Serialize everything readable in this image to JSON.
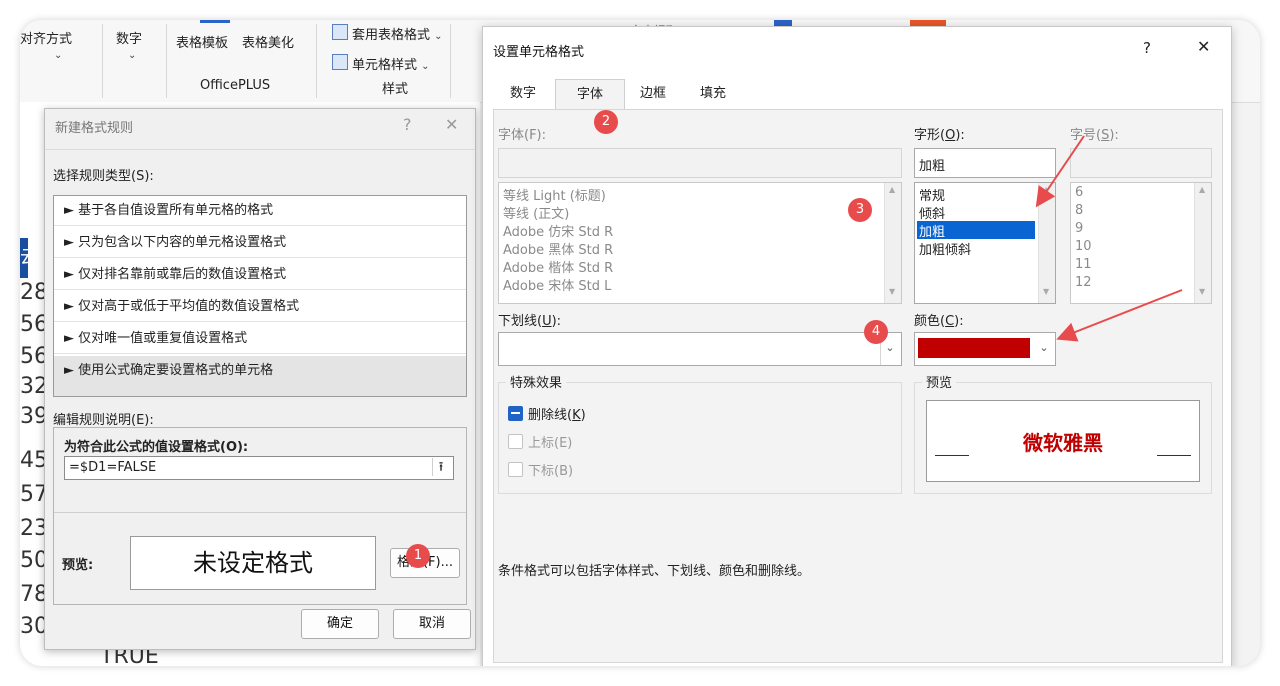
{
  "ribbon": {
    "alignment_label": "对齐方式",
    "number_label": "数字",
    "table_template_label": "表格模板",
    "table_beautify_label": "表格美化",
    "apply_table_style_label": "套用表格格式",
    "cell_style_label": "单元格样式",
    "officeplus_group": "OfficePLUS",
    "style_group": "样式",
    "text_extract_label": "文本提取"
  },
  "sheet": {
    "partial_cells": [
      "28",
      "56",
      "56",
      "32",
      "39",
      "45",
      "57",
      "23",
      "50",
      "78",
      "30"
    ],
    "bottom_cell": "TRUE",
    "left_header_fragment": "云春"
  },
  "new_rule_dialog": {
    "title": "新建格式规则",
    "help": "?",
    "close": "✕",
    "select_rule_type_label": "选择规则类型(S):",
    "rules": [
      "► 基于各自值设置所有单元格的格式",
      "► 只为包含以下内容的单元格设置格式",
      "► 仅对排名靠前或靠后的数值设置格式",
      "► 仅对高于或低于平均值的数值设置格式",
      "► 仅对唯一值或重复值设置格式",
      "► 使用公式确定要设置格式的单元格"
    ],
    "edit_rule_label": "编辑规则说明(E):",
    "formula_label": "为符合此公式的值设置格式(O):",
    "formula_value": "=$D1=FALSE",
    "preview_label": "预览:",
    "preview_text": "未设定格式",
    "format_button": "格式(F)...",
    "ok_button": "确定",
    "cancel_button": "取消"
  },
  "format_cells_dialog": {
    "title": "设置单元格格式",
    "help": "?",
    "close": "✕",
    "tabs": [
      "数字",
      "字体",
      "边框",
      "填充"
    ],
    "active_tab": "字体",
    "font_label": "字体(F):",
    "font_input": "",
    "font_list": [
      "等线 Light (标题)",
      "等线 (正文)",
      "Adobe 仿宋 Std R",
      "Adobe 黑体 Std R",
      "Adobe 楷体 Std R",
      "Adobe 宋体 Std L"
    ],
    "style_label": "字形(O):",
    "style_input": "加粗",
    "style_list": [
      "常规",
      "倾斜",
      "加粗",
      "加粗倾斜"
    ],
    "style_selected": "加粗",
    "size_label": "字号(S):",
    "size_input": "",
    "size_list": [
      "6",
      "8",
      "9",
      "10",
      "11",
      "12"
    ],
    "underline_label": "下划线(U):",
    "underline_value": "",
    "color_label": "颜色(C):",
    "color_value": "#c00000",
    "effects_label": "特殊效果",
    "strikethrough_label": "删除线(K)",
    "superscript_label": "上标(E)",
    "subscript_label": "下标(B)",
    "preview_label": "预览",
    "preview_text": "微软雅黑",
    "preview_color": "#c00000",
    "note": "条件格式可以包括字体样式、下划线、颜色和删除线。"
  },
  "annotations": [
    "1",
    "2",
    "3",
    "4"
  ],
  "accent_color": "#e84b4b",
  "selection_color": "#0a64d2"
}
